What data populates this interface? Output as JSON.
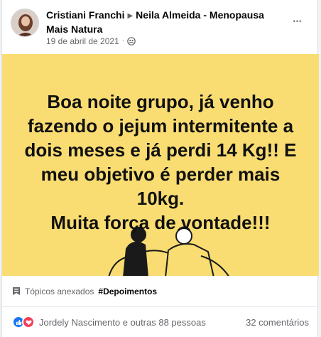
{
  "post": {
    "author": "Cristiani Franchi",
    "group": "Neila Almeida - Menopausa Mais Natura",
    "date": "19 de abril de 2021",
    "dot": "·",
    "more_glyph": "•••",
    "text_lines": [
      "Boa noite grupo, já venho",
      "fazendo o jejum intermitente a",
      "dois meses e já perdi 14 Kg!! E",
      "meu objetivo é perder mais",
      "10kg.",
      "Muita força de vontade!!!"
    ],
    "background_color": "#f9dd72"
  },
  "topics": {
    "label": "Tópicos anexados",
    "tag": "#Depoimentos"
  },
  "reactions": {
    "names": "Jordely Nascimento e outras 88 pessoas",
    "comments": "32 comentários",
    "icons": [
      "like-icon",
      "love-icon"
    ],
    "colors": {
      "like": "#1877f2",
      "love": "#f33e58"
    }
  }
}
